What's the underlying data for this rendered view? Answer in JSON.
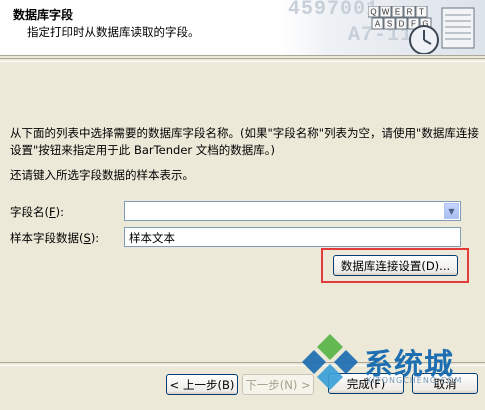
{
  "header": {
    "title": "数据库字段",
    "subtitle": "指定打印时从数据库读取的字段。",
    "art_numbers": [
      "4597001",
      "A7-11"
    ],
    "keyboard_rows": [
      "QWERT",
      "ASDFG"
    ]
  },
  "intro_text": "从下面的列表中选择需要的数据库字段名称。(如果\"字段名称\"列表为空，请使用\"数据库连接设置\"按钮来指定用于此 BarTender 文档的数据库。)",
  "hint_text": "还请键入所选字段数据的样本表示。",
  "field_name": {
    "label": "字段名(",
    "hotkey": "F",
    "label_end": "):",
    "value": ""
  },
  "sample_data": {
    "label": "样本字段数据(",
    "hotkey": "S",
    "label_end": "):",
    "value": "样本文本"
  },
  "db_button": "数据库连接设置(D)...",
  "footer": {
    "back": "< 上一步(B)",
    "next": "下一步(N) >",
    "finish": "完成(F)",
    "cancel": "取消"
  },
  "watermark": {
    "text": "系统城",
    "sub": "XITONGCHENG.COM"
  },
  "colors": {
    "highlight": "#e33a3a",
    "watermark_blue": "#1d6fb1",
    "watermark_green": "#58b446"
  }
}
